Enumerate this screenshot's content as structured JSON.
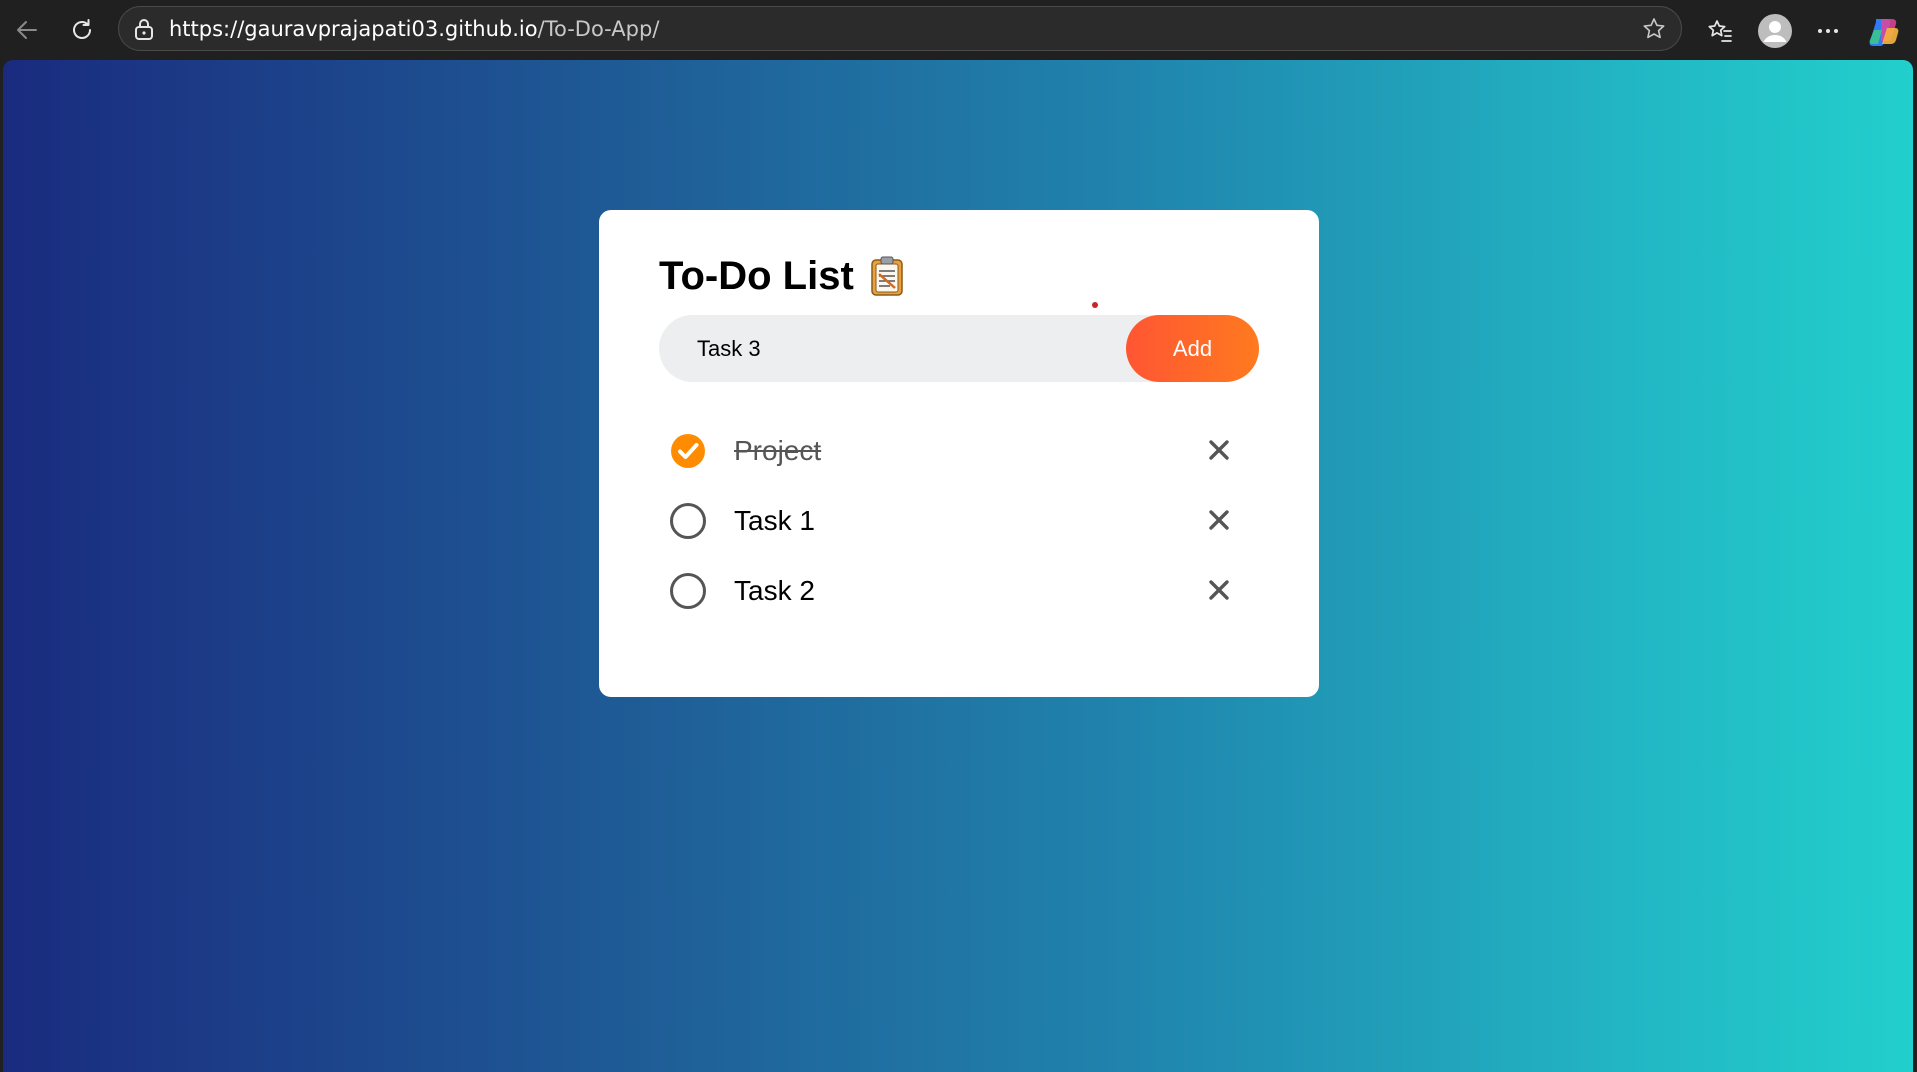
{
  "browser": {
    "url_host": "https://gauravprajapati03.github.io",
    "url_path": "/To-Do-App/",
    "icons": [
      "back-icon",
      "reload-icon",
      "lock-icon",
      "star-icon",
      "favorites-icon",
      "profile-icon",
      "more-icon",
      "copilot-icon"
    ]
  },
  "app": {
    "title": "To-Do List",
    "title_icon": "clipboard-icon",
    "input": {
      "value": "Task 3",
      "placeholder": ""
    },
    "add_label": "Add",
    "tasks": [
      {
        "label": "Project",
        "completed": true
      },
      {
        "label": "Task 1",
        "completed": false
      },
      {
        "label": "Task 2",
        "completed": false
      }
    ],
    "colors": {
      "accent": "#ff5a2d",
      "check": "#ff8c00",
      "gradient_start": "#1a2b7f",
      "gradient_end": "#22cfcc"
    }
  }
}
